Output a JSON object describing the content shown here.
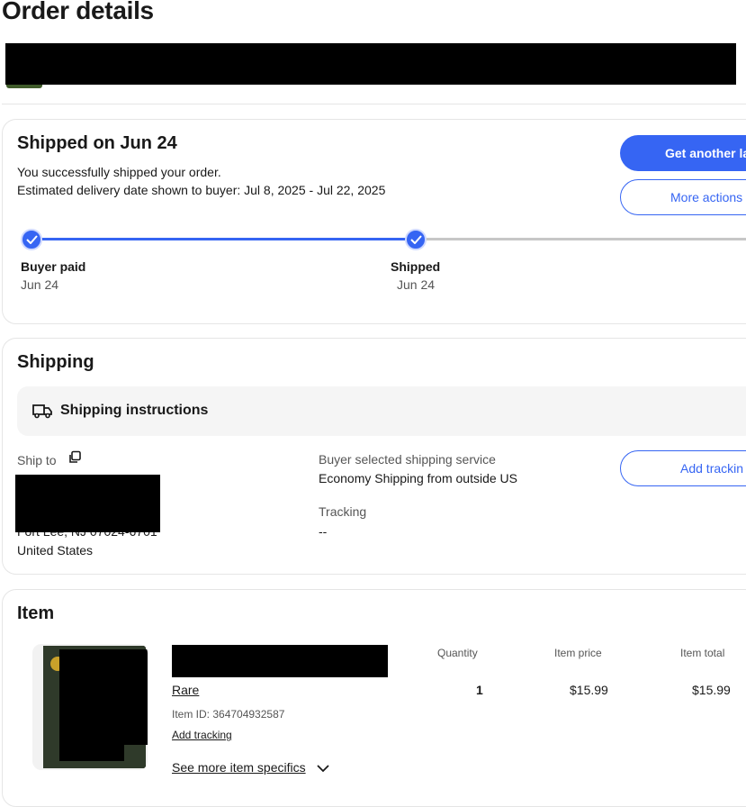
{
  "page": {
    "title": "Order details"
  },
  "status": {
    "heading": "Shipped on Jun 24",
    "message": "You successfully shipped your order.",
    "estimate": "Estimated delivery date shown to buyer: Jul 8, 2025 - Jul 22, 2025",
    "primary_button": "Get another la",
    "secondary_button": "More actions",
    "steps": [
      {
        "label": "Buyer paid",
        "date": "Jun 24"
      },
      {
        "label": "Shipped",
        "date": "Jun 24"
      }
    ]
  },
  "shipping": {
    "heading": "Shipping",
    "instructions_label": "Shipping instructions",
    "ship_to_label": "Ship to",
    "address_visible_line": "Fort Lee, NJ 07024-6701",
    "country": "United States",
    "service_label": "Buyer selected shipping service",
    "service_value": "Economy Shipping from outside US",
    "tracking_label": "Tracking",
    "tracking_value": "--",
    "add_tracking_button": "Add trackin"
  },
  "item": {
    "heading": "Item",
    "columns": {
      "quantity": "Quantity",
      "price": "Item price",
      "total": "Item total"
    },
    "condition": "Rare",
    "item_id": "Item ID: 364704932587",
    "add_tracking_link": "Add tracking",
    "see_more": "See more item specifics",
    "quantity": "1",
    "price": "$15.99",
    "total": "$15.99"
  },
  "colors": {
    "accent": "#3665f3",
    "progress_track": "#c7c7c7"
  }
}
